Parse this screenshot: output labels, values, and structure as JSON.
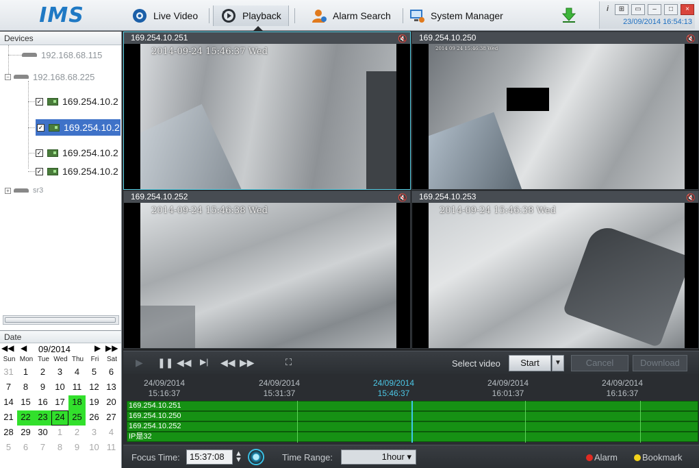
{
  "app": {
    "logo": "IMS",
    "clock": "23/09/2014 16:54:13"
  },
  "nav": [
    {
      "label": "Live Video",
      "icon": "live-video-icon"
    },
    {
      "label": "Playback",
      "icon": "playback-icon",
      "active": true
    },
    {
      "label": "Alarm Search",
      "icon": "alarm-search-icon"
    },
    {
      "label": "System Manager",
      "icon": "system-manager-icon"
    }
  ],
  "devices": {
    "header": "Devices",
    "nodes": [
      {
        "label": "192.168.68.115"
      },
      {
        "label": "192.168.68.225",
        "expanded": true
      },
      {
        "label": "169.254.10.2",
        "checked": true
      },
      {
        "label": "169.254.10.2",
        "checked": true,
        "selected": true
      },
      {
        "label": "169.254.10.2",
        "checked": true
      },
      {
        "label": "169.254.10.2",
        "checked": true
      },
      {
        "label": "sr3"
      }
    ]
  },
  "calendar": {
    "header": "Date",
    "month_year": "09/2014",
    "weekdays": [
      "Sun",
      "Mon",
      "Tue",
      "Wed",
      "Thu",
      "Fri",
      "Sat"
    ],
    "weeks": [
      [
        "31",
        "1",
        "2",
        "3",
        "4",
        "5",
        "6"
      ],
      [
        "7",
        "8",
        "9",
        "10",
        "11",
        "12",
        "13"
      ],
      [
        "14",
        "15",
        "16",
        "17",
        "18",
        "19",
        "20"
      ],
      [
        "21",
        "22",
        "23",
        "24",
        "25",
        "26",
        "27"
      ],
      [
        "28",
        "29",
        "30",
        "1",
        "2",
        "3",
        "4"
      ],
      [
        "5",
        "6",
        "7",
        "8",
        "9",
        "10",
        "11"
      ]
    ],
    "recorded_days": [
      "18",
      "22",
      "23",
      "24",
      "25"
    ],
    "selected_day": "24"
  },
  "videos": [
    {
      "title": "169.254.10.251",
      "osd": "2014-09-24 15:46:37 Wed",
      "active": true
    },
    {
      "title": "169.254.10.250",
      "osd": "2014 09 24 15:46:38 Wed"
    },
    {
      "title": "169.254.10.252",
      "osd": "2014-09-24 15:46:38 Wed"
    },
    {
      "title": "169.254.10.253",
      "osd": "2014-09-24 15:46:38 Wed"
    }
  ],
  "controls": {
    "select_video_label": "Select video",
    "start_label": "Start",
    "cancel_label": "Cancel",
    "download_label": "Download"
  },
  "timeline": {
    "ticks": [
      {
        "date": "24/09/2014",
        "time": "15:16:37"
      },
      {
        "date": "24/09/2014",
        "time": "15:31:37"
      },
      {
        "date": "24/09/2014",
        "time": "15:46:37",
        "current": true
      },
      {
        "date": "24/09/2014",
        "time": "16:01:37"
      },
      {
        "date": "24/09/2014",
        "time": "16:16:37"
      }
    ],
    "tracks": [
      "169.254.10.251",
      "169.254.10.250",
      "169.254.10.252",
      "IP是32"
    ]
  },
  "bottom": {
    "focus_label": "Focus Time:",
    "focus_value": "15:37:08",
    "range_label": "Time Range:",
    "range_value": "1hour ▾",
    "alarm_label": "Alarm",
    "bookmark_label": "Bookmark"
  },
  "colors": {
    "accent": "#1f79c4",
    "record": "#32e02c",
    "track": "#169114",
    "cursor": "#3ec6ea",
    "selected": "#3f72c8"
  }
}
